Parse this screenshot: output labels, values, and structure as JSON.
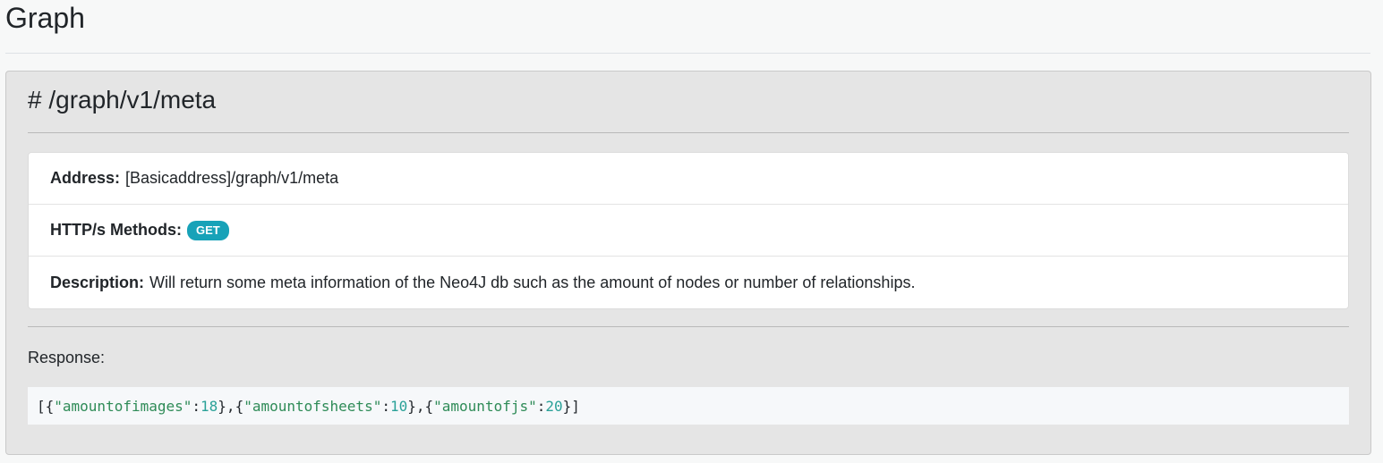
{
  "page": {
    "title": "Graph"
  },
  "endpoint": {
    "title": "# /graph/v1/meta",
    "address": {
      "label": "Address:",
      "value": "[Basicaddress]/graph/v1/meta"
    },
    "methods": {
      "label": "HTTP/s Methods:",
      "badges": [
        "GET"
      ]
    },
    "description": {
      "label": "Description:",
      "value": "Will return some meta information of the Neo4J db such as the amount of nodes or number of relationships."
    },
    "response": {
      "label": "Response:",
      "tokens": [
        {
          "text": "[{",
          "type": "punc"
        },
        {
          "text": "\"amountofimages\"",
          "type": "str"
        },
        {
          "text": ":",
          "type": "punc"
        },
        {
          "text": "18",
          "type": "num"
        },
        {
          "text": "},{",
          "type": "punc"
        },
        {
          "text": "\"amountofsheets\"",
          "type": "str"
        },
        {
          "text": ":",
          "type": "punc"
        },
        {
          "text": "10",
          "type": "num"
        },
        {
          "text": "},{",
          "type": "punc"
        },
        {
          "text": "\"amountofjs\"",
          "type": "str"
        },
        {
          "text": ":",
          "type": "punc"
        },
        {
          "text": "20",
          "type": "num"
        },
        {
          "text": "}]",
          "type": "punc"
        }
      ]
    }
  },
  "colors": {
    "badge_bg": "#17a2b8",
    "string_token": "#2e8b57",
    "number_token": "#2aa198"
  }
}
